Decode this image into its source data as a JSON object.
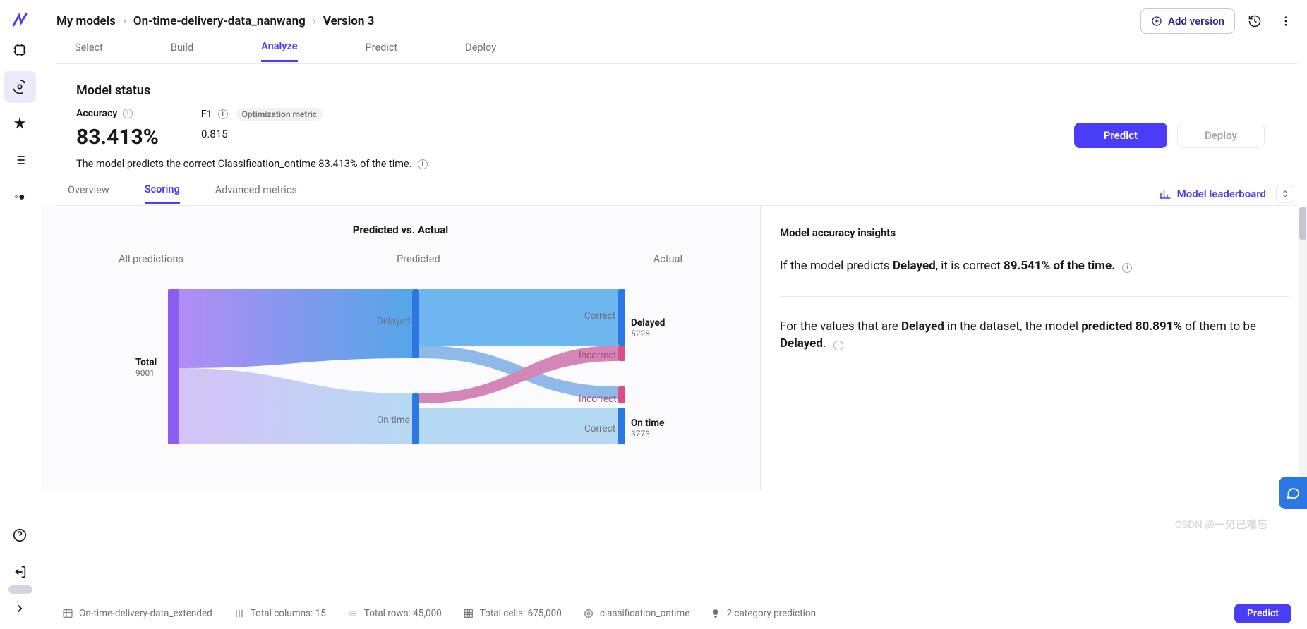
{
  "breadcrumb": {
    "root": "My models",
    "project": "On-time-delivery-data_nanwang",
    "version": "Version 3"
  },
  "top": {
    "add_version": "Add version"
  },
  "steps": {
    "select": "Select",
    "build": "Build",
    "analyze": "Analyze",
    "predict": "Predict",
    "deploy": "Deploy"
  },
  "status": {
    "title": "Model status",
    "accuracy_label": "Accuracy",
    "accuracy_value": "83.413%",
    "f1_label": "F1",
    "f1_value": "0.815",
    "opt_metric": "Optimization metric",
    "description": "The model predicts the correct Classification_ontime 83.413% of the time.",
    "predict_btn": "Predict",
    "deploy_btn": "Deploy"
  },
  "subtabs": {
    "overview": "Overview",
    "scoring": "Scoring",
    "advanced": "Advanced metrics",
    "leaderboard": "Model leaderboard"
  },
  "chart": {
    "title": "Predicted vs. Actual",
    "cols": {
      "allpred": "All predictions",
      "predicted": "Predicted",
      "actual": "Actual"
    },
    "labels": {
      "total": "Total",
      "total_n": "9001",
      "delayed": "Delayed",
      "ontime": "On time",
      "correct": "Correct",
      "incorrect": "Incorrect",
      "delayed_n": "5228",
      "ontime_n": "3773"
    }
  },
  "insights": {
    "title": "Model accuracy insights",
    "c1_a": "If the model predicts ",
    "c1_b": "Delayed",
    "c1_c": ", it is correct ",
    "c1_d": "89.541% of the time.",
    "c2_a": "For the values that are ",
    "c2_b": "Delayed",
    "c2_c": " in the dataset, the model ",
    "c2_d": "predicted 80.891%",
    "c2_e": " of them to be ",
    "c2_f": "Delayed",
    "c2_g": "."
  },
  "bottom": {
    "dataset": "On-time-delivery-data_extended",
    "cols": "Total columns: 15",
    "rows": "Total rows: 45,000",
    "cells": "Total cells: 675,000",
    "target": "classification_ontime",
    "pred": "2 category prediction",
    "predict": "Predict"
  },
  "watermark": "CSDN @一见已难忘",
  "chart_data": {
    "type": "sankey",
    "title": "Predicted vs. Actual",
    "columns": [
      "All predictions",
      "Predicted",
      "Actual"
    ],
    "nodes": [
      {
        "id": "total",
        "col": 0,
        "label": "Total",
        "value": 9001
      },
      {
        "id": "pred_delayed",
        "col": 1,
        "label": "Delayed"
      },
      {
        "id": "pred_ontime",
        "col": 1,
        "label": "On time"
      },
      {
        "id": "act_delayed_correct",
        "col": 2,
        "label": "Correct"
      },
      {
        "id": "act_delayed_incorrect",
        "col": 2,
        "label": "Incorrect"
      },
      {
        "id": "act_ontime_incorrect",
        "col": 2,
        "label": "Incorrect"
      },
      {
        "id": "act_ontime_correct",
        "col": 2,
        "label": "Correct"
      }
    ],
    "links": [
      {
        "source": "total",
        "target": "pred_delayed"
      },
      {
        "source": "total",
        "target": "pred_ontime"
      },
      {
        "source": "pred_delayed",
        "target": "act_delayed_correct"
      },
      {
        "source": "pred_delayed",
        "target": "act_ontime_incorrect"
      },
      {
        "source": "pred_ontime",
        "target": "act_delayed_incorrect"
      },
      {
        "source": "pred_ontime",
        "target": "act_ontime_correct"
      }
    ],
    "final": [
      {
        "label": "Delayed",
        "value": 5228
      },
      {
        "label": "On time",
        "value": 3773
      }
    ],
    "metrics": {
      "precision_delayed": 89.541,
      "recall_delayed": 80.891
    }
  }
}
